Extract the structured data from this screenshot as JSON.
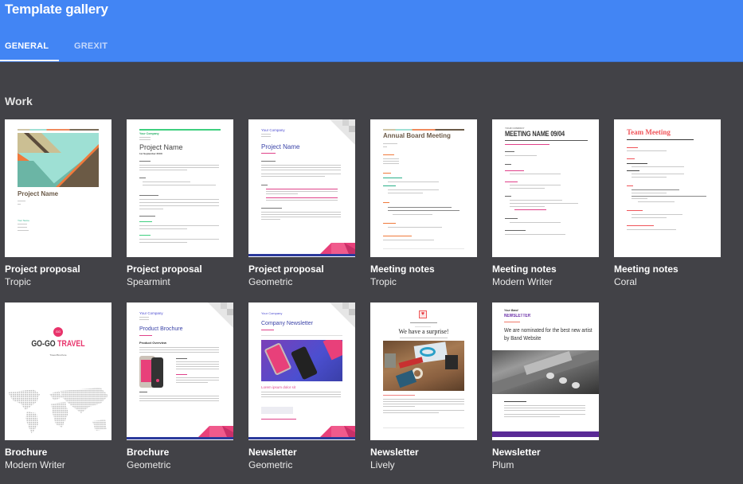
{
  "app": {
    "title": "Template gallery"
  },
  "tabs": [
    {
      "label": "GENERAL",
      "active": true
    },
    {
      "label": "GREXIT",
      "active": false
    }
  ],
  "section": {
    "title": "Work"
  },
  "colors": {
    "header": "#4285f4",
    "background": "#424247"
  },
  "templates": [
    {
      "type": "Project proposal",
      "style": "Tropic",
      "preview": {
        "heading": "Project Name",
        "sub": "Your Name"
      }
    },
    {
      "type": "Project proposal",
      "style": "Spearmint",
      "preview": {
        "company": "Your Company",
        "heading": "Project Name",
        "sub": "1st September 20XX"
      }
    },
    {
      "type": "Project proposal",
      "style": "Geometric",
      "preview": {
        "company": "Your Company",
        "heading": "Project Name",
        "sub": "September 04, 20XX"
      }
    },
    {
      "type": "Meeting notes",
      "style": "Tropic",
      "preview": {
        "heading": "Annual Board Meeting"
      }
    },
    {
      "type": "Meeting notes",
      "style": "Modern Writer",
      "preview": {
        "company": "YOUR COMPANY",
        "heading": "MEETING NAME 09/04"
      }
    },
    {
      "type": "Meeting notes",
      "style": "Coral",
      "preview": {
        "heading": "Team Meeting"
      }
    },
    {
      "type": "Brochure",
      "style": "Modern Writer",
      "preview": {
        "heading_a": "GO-GO",
        "heading_b": "TRAVEL",
        "sub": "Travel Brochure",
        "logo": "GG"
      }
    },
    {
      "type": "Brochure",
      "style": "Geometric",
      "preview": {
        "company": "Your Company",
        "heading": "Product Brochure",
        "sub": "Product Overview"
      }
    },
    {
      "type": "Newsletter",
      "style": "Geometric",
      "preview": {
        "company": "Your Company",
        "heading": "Company Newsletter",
        "sub": "Lorem ipsum dolor sit"
      }
    },
    {
      "type": "Newsletter",
      "style": "Lively",
      "preview": {
        "heading": "We have a surprise!"
      }
    },
    {
      "type": "Newsletter",
      "style": "Plum",
      "preview": {
        "band": "Your Band",
        "kicker": "NEWSLETTER",
        "heading": "We are nominated for the best new artist by Band Website"
      }
    }
  ]
}
